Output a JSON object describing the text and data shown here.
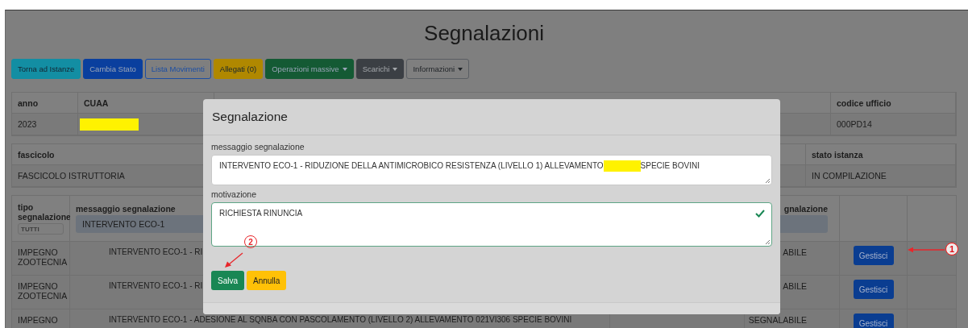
{
  "page_title": "Segnalazioni",
  "toolbar": [
    {
      "label": "Torna ad Istanze",
      "kind": "solid",
      "color": "#138ea3",
      "dropdown": false
    },
    {
      "label": "Cambia Stato",
      "kind": "solid",
      "color": "#0a3f9e",
      "dropdown": false
    },
    {
      "label": "Lista Movimenti",
      "kind": "outline",
      "color": "#1c4ea3",
      "dropdown": false
    },
    {
      "label": "Allegati (0)",
      "kind": "solid",
      "color": "#b08800",
      "dropdown": false
    },
    {
      "label": "Operazioni massive",
      "kind": "solid",
      "color": "#145a34",
      "dropdown": true
    },
    {
      "label": "Scarichi",
      "kind": "solid",
      "color": "#3b3f44",
      "dropdown": true
    },
    {
      "label": "Informazioni",
      "kind": "outline",
      "color": "#5a5e63",
      "dropdown": true
    }
  ],
  "header_table": {
    "anno_label": "anno",
    "anno": "2023",
    "cuaa_label": "CUAA",
    "codice_ufficio_label": "codice ufficio",
    "codice_ufficio": "000PD14"
  },
  "fascicolo_table": {
    "fascicolo_label": "fascicolo",
    "fascicolo": "FASCICOLO ISTRUTTORIA",
    "stato_istanza_label": "stato istanza",
    "stato_istanza": "IN COMPILAZIONE"
  },
  "signals_table": {
    "columns": [
      "tipo\nsegnalazione",
      "messaggio segnalazione",
      "gnalazione"
    ],
    "filters": {
      "tipo_placeholder": "TUTTI",
      "messaggio": "INTERVENTO ECO-1"
    },
    "rows": [
      {
        "tipo": "IMPEGNO\nZOOTECNIA",
        "messaggio": "INTERVENTO ECO-1 - RI",
        "stato": "ABILE",
        "action": "Gestisci"
      },
      {
        "tipo": "IMPEGNO\nZOOTECNIA",
        "messaggio": "INTERVENTO ECO-1 - RI",
        "stato": "ABILE",
        "action": "Gestisci"
      },
      {
        "tipo": "IMPEGNO",
        "messaggio": "INTERVENTO ECO-1 - ADESIONE AL SQNBA CON PASCOLAMENTO (LIVELLO 2) ALLEVAMENTO 021VI306 SPECIE BOVINI",
        "stato": "SEGNALABILE",
        "action": "Gestisci"
      }
    ]
  },
  "modal": {
    "title": "Segnalazione",
    "message_label": "messaggio segnalazione",
    "message_before": "INTERVENTO ECO-1 - RIDUZIONE DELLA ANTIMICROBICO RESISTENZA (LIVELLO 1) ALLEVAMENTO",
    "message_after": "SPECIE BOVINI",
    "reason_label": "motivazione",
    "reason": "RICHIESTA RINUNCIA",
    "reason_valid": true,
    "buttons": [
      {
        "label": "Salva",
        "color": "#198754"
      },
      {
        "label": "Annulla",
        "color": "#ffc107"
      }
    ]
  },
  "annotations": [
    "1",
    "2"
  ]
}
